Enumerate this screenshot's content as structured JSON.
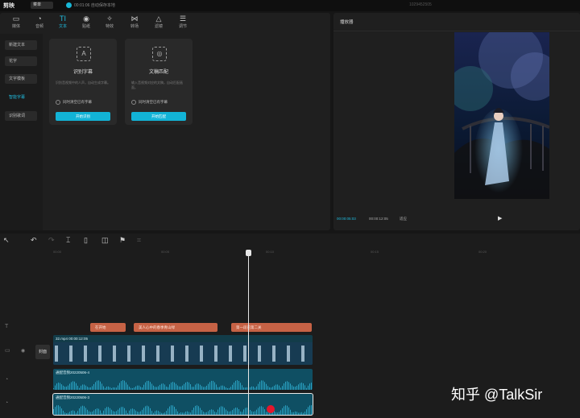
{
  "topbar": {
    "app_name": "剪映",
    "menu": "菜单",
    "autosave": "00:01:06 自动保存本地",
    "project_name": "1029452505"
  },
  "tabs": [
    {
      "label": "媒体",
      "icon": "media-icon"
    },
    {
      "label": "音频",
      "icon": "audio-icon"
    },
    {
      "label": "文本",
      "icon": "text-icon"
    },
    {
      "label": "贴纸",
      "icon": "sticker-icon"
    },
    {
      "label": "特效",
      "icon": "effects-icon"
    },
    {
      "label": "转场",
      "icon": "transition-icon"
    },
    {
      "label": "滤镜",
      "icon": "filter-icon"
    },
    {
      "label": "调节",
      "icon": "adjust-icon"
    }
  ],
  "sidenav": [
    "新建文本",
    "花字",
    "文字模板",
    "智能字幕",
    "识别歌词"
  ],
  "cards": [
    {
      "title": "识别字幕",
      "desc": "识别音视频中的人声，自动生成字幕。",
      "check": "同时清空已有字幕",
      "button": "开始识别"
    },
    {
      "title": "文稿匹配",
      "desc": "输入音视频对应的文稿，自动匹配画面。",
      "check": "同时清空已有字幕",
      "button": "开始匹配"
    }
  ],
  "player": {
    "title": "播放器",
    "current_time": "00:00:05:03",
    "total_time": "00:00:12:05",
    "quality": "适应"
  },
  "ruler": [
    "00:00",
    "00:05",
    "00:10",
    "00:15",
    "00:20"
  ],
  "timeline": {
    "cover_label": "封面",
    "text_clips": [
      "在开始",
      "美人心中的春季青山绿",
      "第一段已第二关"
    ],
    "video_clip": "32.mp4 00:00:12:05",
    "audio_clips": [
      "通配音频20220506-4",
      "通配音频20220506-3"
    ]
  },
  "watermark": "知乎 @TalkSir"
}
